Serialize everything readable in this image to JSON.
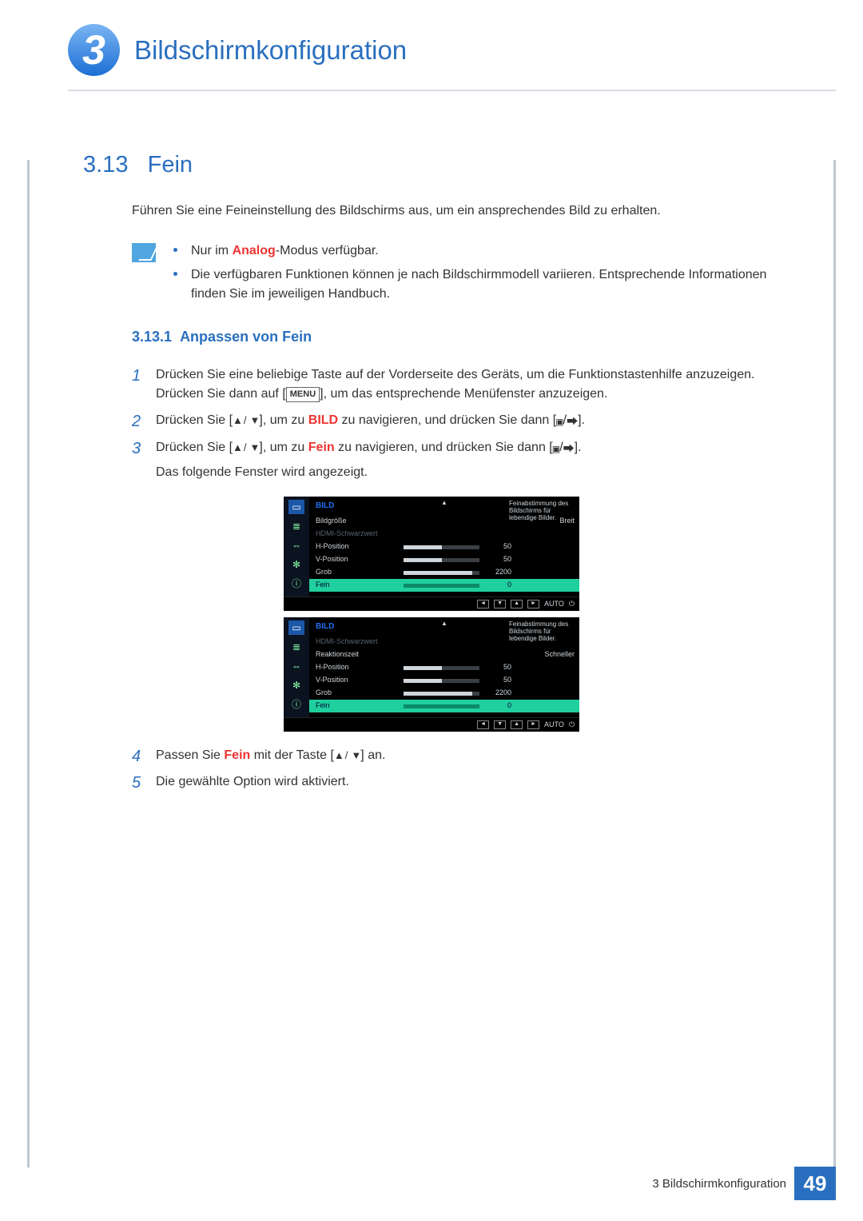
{
  "chapter": {
    "number": "3",
    "title": "Bildschirmkonfiguration"
  },
  "section": {
    "number": "3.13",
    "title": "Fein",
    "intro": "Führen Sie eine Feineinstellung des Bildschirms aus, um ein ansprechendes Bild zu erhalten."
  },
  "notes": {
    "item1_prefix": "Nur im ",
    "item1_emph": "Analog",
    "item1_suffix": "-Modus verfügbar.",
    "item2": "Die verfügbaren Funktionen können je nach Bildschirmmodell variieren. Entsprechende Informationen finden Sie im jeweiligen Handbuch."
  },
  "subsection": {
    "number": "3.13.1",
    "title": "Anpassen von Fein"
  },
  "steps": {
    "s1_a": "Drücken Sie eine beliebige Taste auf der Vorderseite des Geräts, um die Funktionstastenhilfe anzuzeigen. Drücken Sie dann auf [",
    "s1_menu": "MENU",
    "s1_b": "], um das entsprechende Menüfenster anzuzeigen.",
    "s2_a": "Drücken Sie [",
    "s2_b": "], um zu ",
    "s2_target": "BILD",
    "s2_c": " zu navigieren, und drücken Sie dann [",
    "s2_d": "].",
    "s3_a": "Drücken Sie [",
    "s3_b": "], um zu ",
    "s3_target": "Fein",
    "s3_c": " zu navigieren, und drücken Sie dann [",
    "s3_d": "].",
    "s3_extra": "Das folgende Fenster wird angezeigt.",
    "s4_a": "Passen Sie ",
    "s4_target": "Fein",
    "s4_b": " mit der Taste [",
    "s4_c": "] an.",
    "s5": "Die gewählte Option wird aktiviert."
  },
  "osd": {
    "title": "BILD",
    "desc": "Feinabstimmung des Bildschirms für lebendige Bilder.",
    "footer_auto": "AUTO",
    "menu1": {
      "rows": [
        {
          "label": "Bildgröße",
          "value_text": "Breit"
        },
        {
          "label": "HDMI-Schwarzwert",
          "dim": true
        },
        {
          "label": "H-Position",
          "bar": 50,
          "max": 100,
          "val": "50"
        },
        {
          "label": "V-Position",
          "bar": 50,
          "max": 100,
          "val": "50"
        },
        {
          "label": "Grob",
          "bar": 90,
          "max": 100,
          "val": "2200"
        },
        {
          "label": "Fein",
          "bar": 0,
          "max": 100,
          "val": "0",
          "highlight": true
        }
      ]
    },
    "menu2": {
      "rows": [
        {
          "label": "HDMI-Schwarzwert",
          "dim": true
        },
        {
          "label": "Reaktionszeit",
          "value_text": "Schneller"
        },
        {
          "label": "H-Position",
          "bar": 50,
          "max": 100,
          "val": "50"
        },
        {
          "label": "V-Position",
          "bar": 50,
          "max": 100,
          "val": "50"
        },
        {
          "label": "Grob",
          "bar": 90,
          "max": 100,
          "val": "2200"
        },
        {
          "label": "Fein",
          "bar": 0,
          "max": 100,
          "val": "0",
          "highlight": true
        }
      ]
    }
  },
  "footer": {
    "label": "3 Bildschirmkonfiguration",
    "page": "49"
  }
}
